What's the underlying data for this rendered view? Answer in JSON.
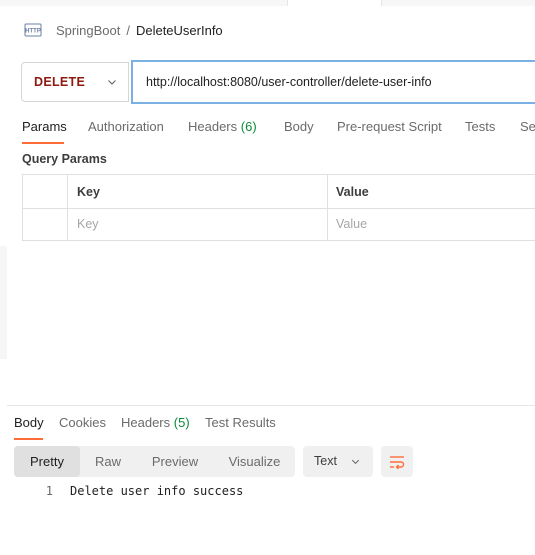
{
  "breadcrumb": {
    "icon": "http-request-icon",
    "collection": "SpringBoot",
    "separator": "/",
    "request": "DeleteUserInfo"
  },
  "request": {
    "method": "DELETE",
    "url": "http://localhost:8080/user-controller/delete-user-info"
  },
  "request_tabs": {
    "params": "Params",
    "authorization": "Authorization",
    "headers": "Headers",
    "headers_count": "(6)",
    "body": "Body",
    "pre_request": "Pre-request Script",
    "tests": "Tests",
    "settings": "Se"
  },
  "query_params": {
    "title": "Query Params",
    "columns": {
      "key": "Key",
      "value": "Value"
    },
    "placeholders": {
      "key": "Key",
      "value": "Value"
    }
  },
  "response_tabs": {
    "body": "Body",
    "cookies": "Cookies",
    "headers": "Headers",
    "headers_count": "(5)",
    "test_results": "Test Results"
  },
  "view_modes": {
    "pretty": "Pretty",
    "raw": "Raw",
    "preview": "Preview",
    "visualize": "Visualize"
  },
  "format": {
    "selected": "Text"
  },
  "response_body": {
    "lines": [
      {
        "number": "1",
        "text": "Delete user info success"
      }
    ]
  },
  "colors": {
    "method": "#8e1a10",
    "accent": "#ff6c37",
    "count": "#0a8a3a",
    "url_focus": "#7bb0e4"
  }
}
